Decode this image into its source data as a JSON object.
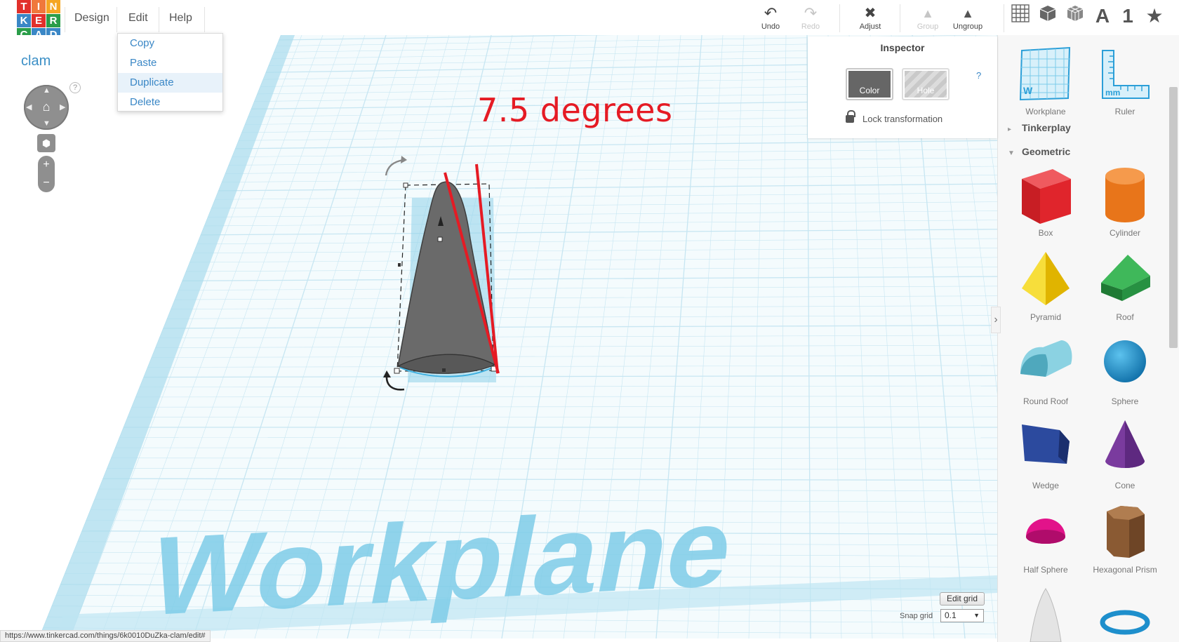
{
  "logo": {
    "letters": [
      {
        "ch": "T",
        "color": "#e2302b"
      },
      {
        "ch": "I",
        "color": "#f0783c"
      },
      {
        "ch": "N",
        "color": "#f5a623"
      },
      {
        "ch": "K",
        "color": "#3a87c6"
      },
      {
        "ch": "E",
        "color": "#e2302b"
      },
      {
        "ch": "R",
        "color": "#2a9d49"
      },
      {
        "ch": "C",
        "color": "#2a9d49"
      },
      {
        "ch": "A",
        "color": "#3a87c6"
      },
      {
        "ch": "D",
        "color": "#3a87c6"
      }
    ]
  },
  "menu": {
    "design": "Design",
    "edit": "Edit",
    "help": "Help",
    "edit_items": [
      "Copy",
      "Paste",
      "Duplicate",
      "Delete"
    ],
    "highlighted": "Duplicate"
  },
  "toolbar": {
    "undo": "Undo",
    "redo": "Redo",
    "adjust": "Adjust",
    "group": "Group",
    "ungroup": "Ungroup",
    "right_icons": [
      "grid-view-icon",
      "box-view-icon",
      "wire-view-icon",
      "text-icon",
      "number-icon",
      "favorites-star-icon"
    ],
    "text_icon_glyph": "A",
    "number_icon_glyph": "1"
  },
  "project": {
    "name": "clam",
    "help": "?"
  },
  "annotation": {
    "text": "7.5 degrees",
    "color": "#e51b24"
  },
  "workplane": {
    "label": "Workplane",
    "line_color": "#c7e6f2",
    "label_color": "#7fcde8"
  },
  "inspector": {
    "title": "Inspector",
    "color_label": "Color",
    "hole_label": "Hole",
    "help": "?",
    "lock_label": "Lock transformation"
  },
  "grid_controls": {
    "edit_grid": "Edit grid",
    "snap_label": "Snap grid",
    "snap_value": "0.1"
  },
  "status_url": "https://www.tinkercad.com/things/6k0010DuZka-clam/edit#",
  "right_panel": {
    "top_items": [
      "Workplane",
      "Ruler"
    ],
    "categories": [
      "Tinkerplay",
      "Geometric"
    ],
    "shapes": [
      {
        "name": "Box",
        "color": "#d9252b"
      },
      {
        "name": "Cylinder",
        "color": "#e8751a"
      },
      {
        "name": "Pyramid",
        "color": "#f2cc14"
      },
      {
        "name": "Roof",
        "color": "#2e9c45"
      },
      {
        "name": "Round Roof",
        "color": "#6bc3d6"
      },
      {
        "name": "Sphere",
        "color": "#1e8fcc"
      },
      {
        "name": "Wedge",
        "color": "#233f8c"
      },
      {
        "name": "Cone",
        "color": "#7a3b9e"
      },
      {
        "name": "Half Sphere",
        "color": "#e2138a"
      },
      {
        "name": "Hexagonal Prism",
        "color": "#8a5a33"
      }
    ]
  }
}
